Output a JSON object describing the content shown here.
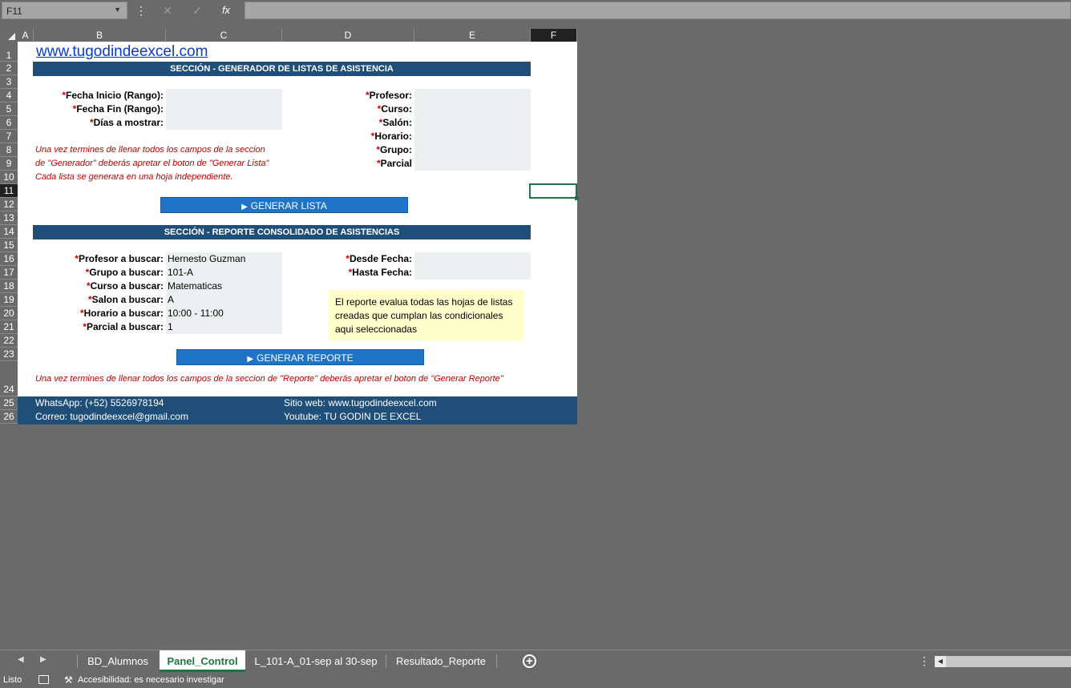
{
  "formula_bar": {
    "name_box": "F11",
    "cancel_icon": "✕",
    "enter_icon": "✓",
    "function_icon": "fx",
    "formula": ""
  },
  "columns": [
    "A",
    "B",
    "C",
    "D",
    "E",
    "F"
  ],
  "rows": [
    "1",
    "2",
    "3",
    "4",
    "5",
    "6",
    "7",
    "8",
    "9",
    "10",
    "11",
    "12",
    "13",
    "14",
    "15",
    "16",
    "17",
    "18",
    "19",
    "20",
    "21",
    "22",
    "23",
    "24",
    "25",
    "26"
  ],
  "sheet": {
    "link": "www.tugodindeexcel.com",
    "section1_title": "SECCIÓN - GENERADOR DE LISTAS DE ASISTENCIA",
    "required_mark": "*",
    "gen_left_labels": [
      "Fecha Inicio (Rango):",
      "Fecha Fin (Rango):",
      "Días a mostrar:"
    ],
    "gen_right_labels": [
      "Profesor:",
      "Curso:",
      "Salón:",
      "Horario:",
      "Grupo:",
      "Parcial"
    ],
    "gen_notes": [
      "Una vez termines de llenar todos los campos de la seccion",
      "de \"Generador\" deberás apretar el boton de \"Generar Lista\"",
      "Cada lista se generara en una hoja independiente."
    ],
    "generate_list_button": "GENERAR LISTA",
    "section2_title": "SECCIÓN - REPORTE CONSOLIDADO DE ASISTENCIAS",
    "rep_left_labels": [
      "Profesor a buscar:",
      "Grupo a buscar:",
      "Curso a buscar:",
      "Salon a buscar:",
      "Horario a buscar:",
      "Parcial a buscar:"
    ],
    "rep_left_values": [
      "Hernesto Guzman",
      "101-A",
      "Matematicas",
      "A",
      "10:00 - 11:00",
      "1"
    ],
    "rep_right_labels": [
      "Desde Fecha:",
      "Hasta Fecha:"
    ],
    "tip_lines": [
      "El reporte evalua todas las hojas de listas",
      "creadas que cumplan las condicionales",
      "aqui seleccionadas"
    ],
    "generate_report_button": "GENERAR REPORTE",
    "report_note": "Una vez termines de llenar todos los campos de la seccion de \"Reporte\" deberás apretar el boton de \"Generar Reporte\"",
    "footer": {
      "whatsapp": "WhatsApp: (+52) 5526978194",
      "email": "Correo: tugodindeexcel@gmail.com",
      "website": "Sitio web: www.tugodindeexcel.com",
      "youtube": "Youtube: TU GODIN DE EXCEL"
    }
  },
  "tabs": [
    "BD_Alumnos",
    "Panel_Control",
    "L_101-A_01-sep al 30-sep",
    "Resultado_Reporte"
  ],
  "active_tab": "Panel_Control",
  "status": {
    "ready": "Listo",
    "accessibility": "Accesibilidad: es necesario investigar"
  },
  "colors": {
    "header_bar": "#1f4e79",
    "button": "#1f74c8",
    "required": "#d00000",
    "excel_green": "#217346",
    "tip_bg": "#ffffcc"
  }
}
